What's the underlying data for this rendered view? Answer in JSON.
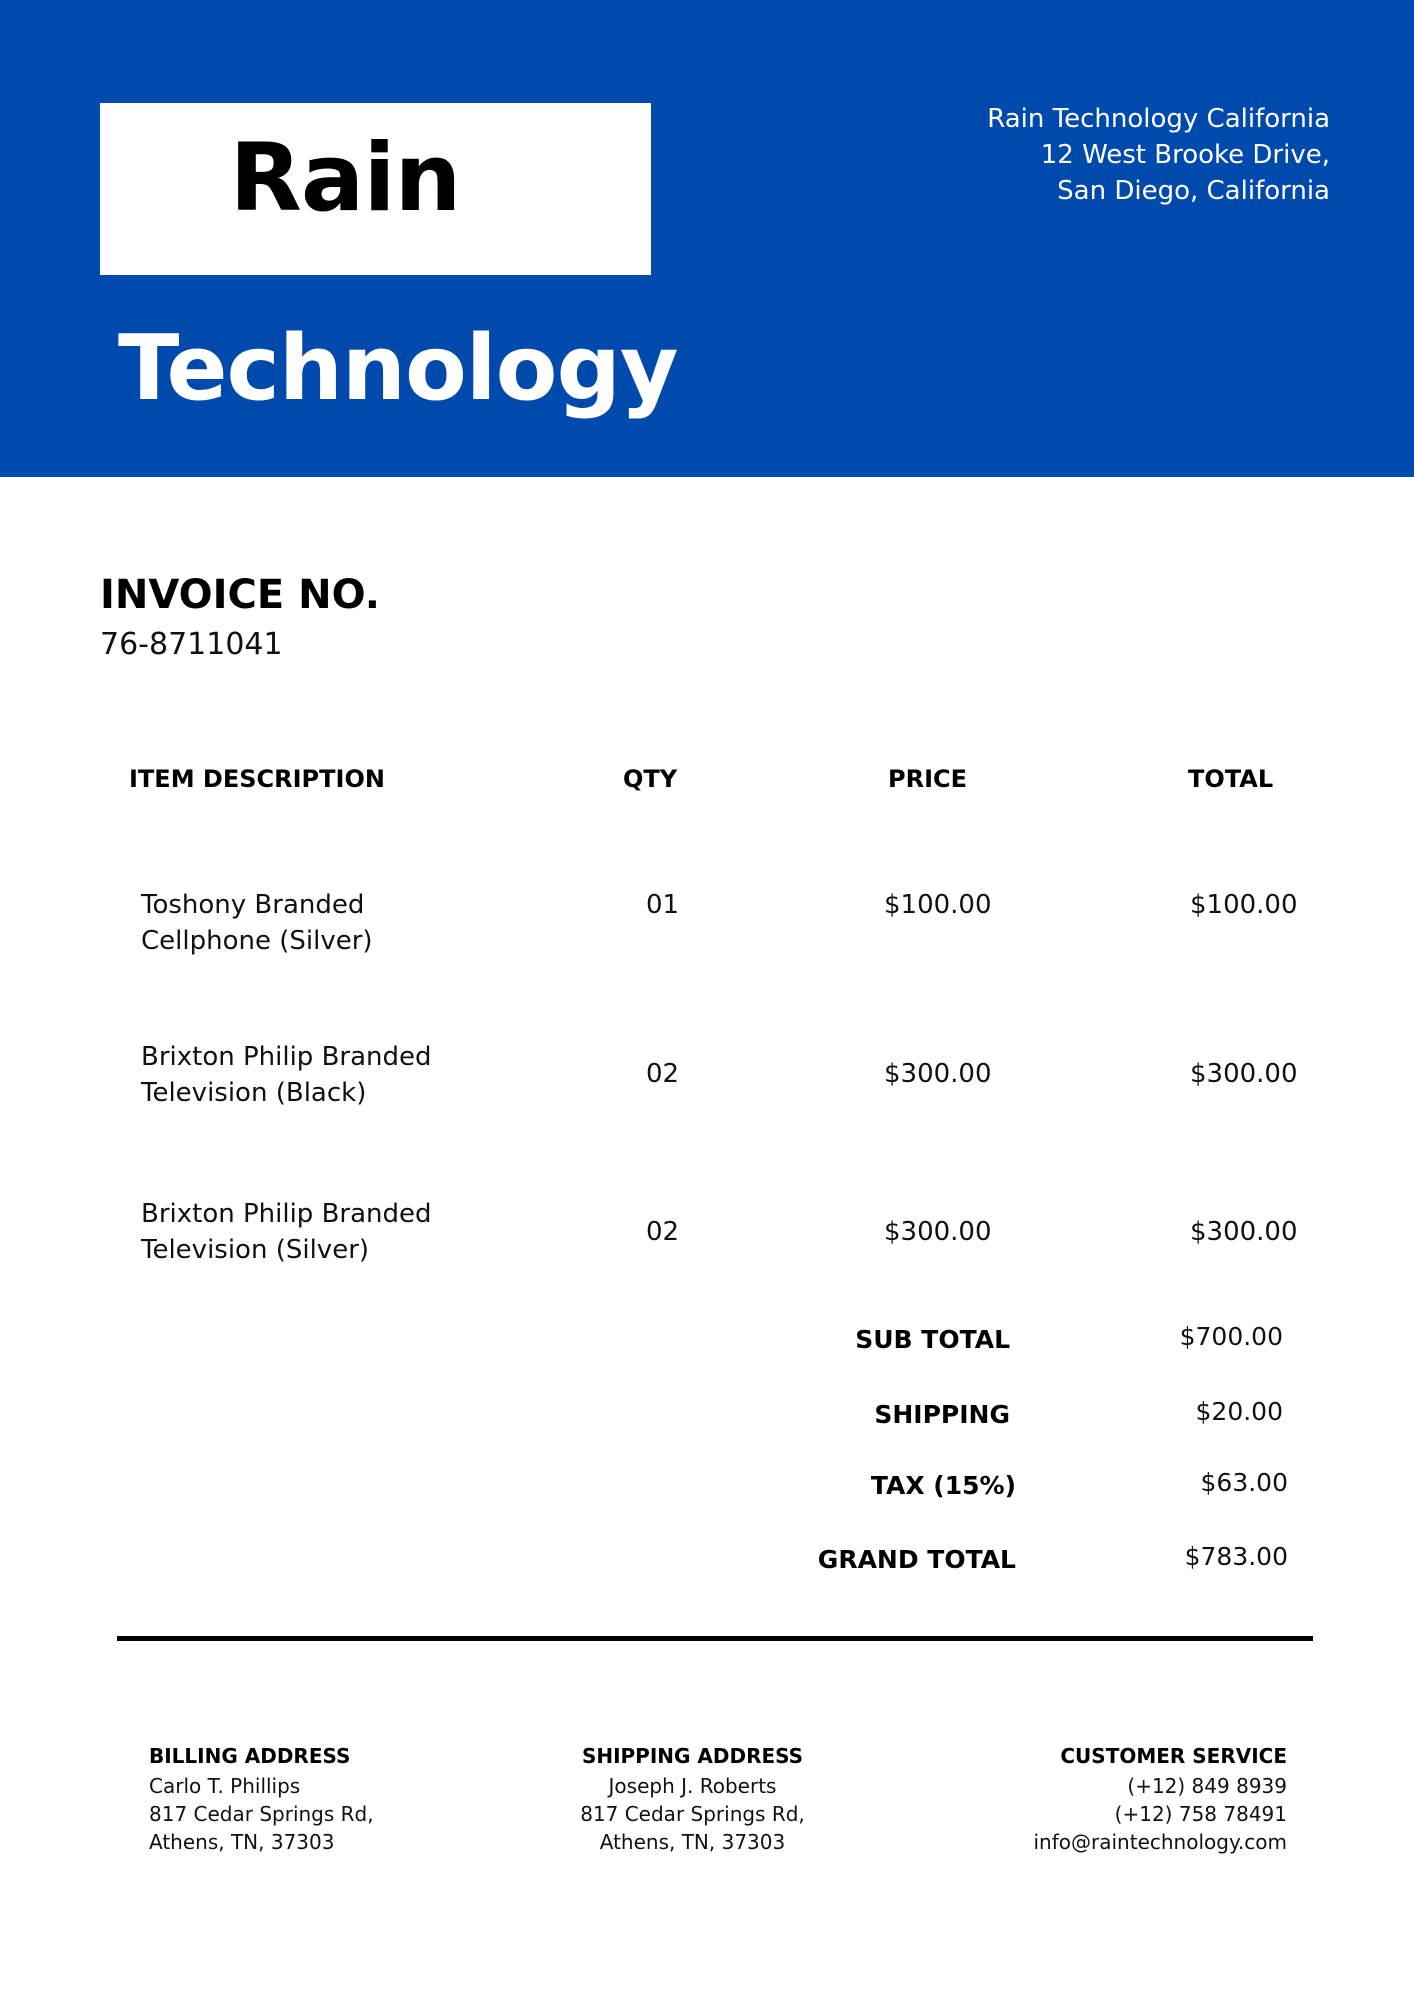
{
  "header": {
    "brand_top": "Rain",
    "brand_bottom": "Technology",
    "address_lines": [
      "Rain Technology California",
      "12 West Brooke Drive,",
      "San Diego, California"
    ],
    "band_color": "#004aad"
  },
  "invoice": {
    "title": "INVOICE NO.",
    "number": "76-8711041"
  },
  "table": {
    "columns": [
      "ITEM DESCRIPTION",
      "QTY",
      "PRICE",
      "TOTAL"
    ],
    "rows": [
      {
        "description": [
          "Toshony Branded",
          "Cellphone (Silver)"
        ],
        "qty": "01",
        "price": "$100.00",
        "total": "$100.00"
      },
      {
        "description": [
          "Brixton Philip Branded",
          "Television (Black)"
        ],
        "qty": "02",
        "price": "$300.00",
        "total": "$300.00"
      },
      {
        "description": [
          "Brixton Philip Branded",
          "Television (Silver)"
        ],
        "qty": "02",
        "price": "$300.00",
        "total": "$300.00"
      }
    ]
  },
  "summary": [
    {
      "label": "SUB TOTAL",
      "value": "$700.00"
    },
    {
      "label": "SHIPPING",
      "value": "$20.00"
    },
    {
      "label": "TAX (15%)",
      "value": "$63.00"
    },
    {
      "label": "GRAND TOTAL",
      "value": "$783.00"
    }
  ],
  "footer": {
    "billing": {
      "heading": "BILLING ADDRESS",
      "lines": [
        "Carlo T. Phillips",
        "817 Cedar Springs Rd,",
        "Athens, TN, 37303"
      ]
    },
    "shipping": {
      "heading": "SHIPPING ADDRESS",
      "lines": [
        "Joseph J. Roberts",
        "817 Cedar Springs Rd,",
        "Athens, TN, 37303"
      ]
    },
    "service": {
      "heading": "CUSTOMER SERVICE",
      "lines": [
        "(+12) 849 8939",
        "(+12) 758 78491",
        "info@raintechnology.com"
      ]
    }
  }
}
